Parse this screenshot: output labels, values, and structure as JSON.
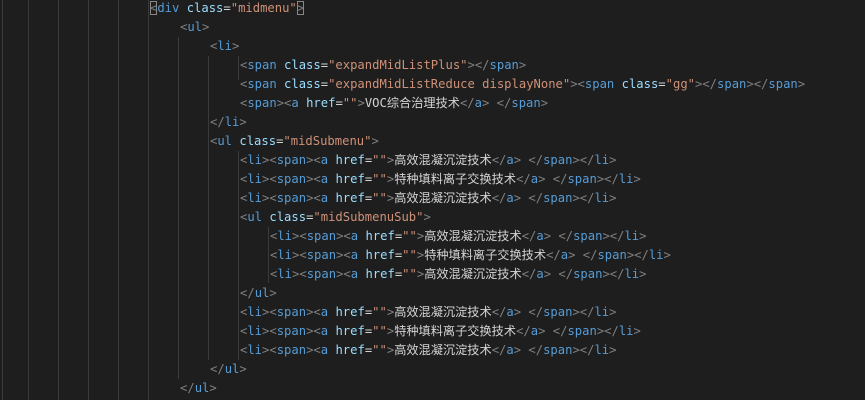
{
  "code_lines": [
    {
      "indent": 0,
      "tokens": [
        {
          "t": "<",
          "c": "ab",
          "m": true
        },
        {
          "t": "div",
          "c": "tg"
        },
        {
          "t": " ",
          "c": "tx"
        },
        {
          "t": "class",
          "c": "at"
        },
        {
          "t": "=",
          "c": "eq"
        },
        {
          "t": "\"midmenu\"",
          "c": "st"
        },
        {
          "t": ">",
          "c": "ab",
          "m": true
        }
      ]
    },
    {
      "indent": 1,
      "tokens": [
        {
          "t": "<",
          "c": "ab"
        },
        {
          "t": "ul",
          "c": "tg"
        },
        {
          "t": ">",
          "c": "ab"
        }
      ]
    },
    {
      "indent": 2,
      "tokens": [
        {
          "t": "<",
          "c": "ab"
        },
        {
          "t": "li",
          "c": "tg"
        },
        {
          "t": ">",
          "c": "ab"
        }
      ]
    },
    {
      "indent": 3,
      "tokens": [
        {
          "t": "<",
          "c": "ab"
        },
        {
          "t": "span",
          "c": "tg"
        },
        {
          "t": " ",
          "c": "tx"
        },
        {
          "t": "class",
          "c": "at"
        },
        {
          "t": "=",
          "c": "eq"
        },
        {
          "t": "\"expandMidListPlus\"",
          "c": "st"
        },
        {
          "t": "></",
          "c": "ab"
        },
        {
          "t": "span",
          "c": "tg"
        },
        {
          "t": ">",
          "c": "ab"
        }
      ]
    },
    {
      "indent": 3,
      "tokens": [
        {
          "t": "<",
          "c": "ab"
        },
        {
          "t": "span",
          "c": "tg"
        },
        {
          "t": " ",
          "c": "tx"
        },
        {
          "t": "class",
          "c": "at"
        },
        {
          "t": "=",
          "c": "eq"
        },
        {
          "t": "\"expandMidListReduce displayNone\"",
          "c": "st"
        },
        {
          "t": "><",
          "c": "ab"
        },
        {
          "t": "span",
          "c": "tg"
        },
        {
          "t": " ",
          "c": "tx"
        },
        {
          "t": "class",
          "c": "at"
        },
        {
          "t": "=",
          "c": "eq"
        },
        {
          "t": "\"gg\"",
          "c": "st"
        },
        {
          "t": "></",
          "c": "ab"
        },
        {
          "t": "span",
          "c": "tg"
        },
        {
          "t": "></",
          "c": "ab"
        },
        {
          "t": "span",
          "c": "tg"
        },
        {
          "t": ">",
          "c": "ab"
        }
      ]
    },
    {
      "indent": 3,
      "tokens": [
        {
          "t": "<",
          "c": "ab"
        },
        {
          "t": "span",
          "c": "tg"
        },
        {
          "t": "><",
          "c": "ab"
        },
        {
          "t": "a",
          "c": "tg"
        },
        {
          "t": " ",
          "c": "tx"
        },
        {
          "t": "href",
          "c": "at"
        },
        {
          "t": "=",
          "c": "eq"
        },
        {
          "t": "\"\"",
          "c": "st"
        },
        {
          "t": ">",
          "c": "ab"
        },
        {
          "t": "VOC综合治理技术",
          "c": "tx"
        },
        {
          "t": "</",
          "c": "ab"
        },
        {
          "t": "a",
          "c": "tg"
        },
        {
          "t": ">",
          "c": "ab"
        },
        {
          "t": " ",
          "c": "tx"
        },
        {
          "t": "</",
          "c": "ab"
        },
        {
          "t": "span",
          "c": "tg"
        },
        {
          "t": ">",
          "c": "ab"
        }
      ]
    },
    {
      "indent": 2,
      "tokens": [
        {
          "t": "</",
          "c": "ab"
        },
        {
          "t": "li",
          "c": "tg"
        },
        {
          "t": ">",
          "c": "ab"
        }
      ]
    },
    {
      "indent": 2,
      "tokens": [
        {
          "t": "<",
          "c": "ab"
        },
        {
          "t": "ul",
          "c": "tg"
        },
        {
          "t": " ",
          "c": "tx"
        },
        {
          "t": "class",
          "c": "at"
        },
        {
          "t": "=",
          "c": "eq"
        },
        {
          "t": "\"midSubmenu\"",
          "c": "st"
        },
        {
          "t": ">",
          "c": "ab"
        }
      ]
    },
    {
      "indent": 3,
      "tokens": [
        {
          "t": "<",
          "c": "ab"
        },
        {
          "t": "li",
          "c": "tg"
        },
        {
          "t": "><",
          "c": "ab"
        },
        {
          "t": "span",
          "c": "tg"
        },
        {
          "t": "><",
          "c": "ab"
        },
        {
          "t": "a",
          "c": "tg"
        },
        {
          "t": " ",
          "c": "tx"
        },
        {
          "t": "href",
          "c": "at"
        },
        {
          "t": "=",
          "c": "eq"
        },
        {
          "t": "\"\"",
          "c": "st"
        },
        {
          "t": ">",
          "c": "ab"
        },
        {
          "t": "高效混凝沉淀技术",
          "c": "tx"
        },
        {
          "t": "</",
          "c": "ab"
        },
        {
          "t": "a",
          "c": "tg"
        },
        {
          "t": ">",
          "c": "ab"
        },
        {
          "t": " ",
          "c": "tx"
        },
        {
          "t": "</",
          "c": "ab"
        },
        {
          "t": "span",
          "c": "tg"
        },
        {
          "t": "></",
          "c": "ab"
        },
        {
          "t": "li",
          "c": "tg"
        },
        {
          "t": ">",
          "c": "ab"
        }
      ]
    },
    {
      "indent": 3,
      "tokens": [
        {
          "t": "<",
          "c": "ab"
        },
        {
          "t": "li",
          "c": "tg"
        },
        {
          "t": "><",
          "c": "ab"
        },
        {
          "t": "span",
          "c": "tg"
        },
        {
          "t": "><",
          "c": "ab"
        },
        {
          "t": "a",
          "c": "tg"
        },
        {
          "t": " ",
          "c": "tx"
        },
        {
          "t": "href",
          "c": "at"
        },
        {
          "t": "=",
          "c": "eq"
        },
        {
          "t": "\"\"",
          "c": "st"
        },
        {
          "t": ">",
          "c": "ab"
        },
        {
          "t": "特种填料离子交换技术",
          "c": "tx"
        },
        {
          "t": "</",
          "c": "ab"
        },
        {
          "t": "a",
          "c": "tg"
        },
        {
          "t": ">",
          "c": "ab"
        },
        {
          "t": " ",
          "c": "tx"
        },
        {
          "t": "</",
          "c": "ab"
        },
        {
          "t": "span",
          "c": "tg"
        },
        {
          "t": "></",
          "c": "ab"
        },
        {
          "t": "li",
          "c": "tg"
        },
        {
          "t": ">",
          "c": "ab"
        }
      ]
    },
    {
      "indent": 3,
      "tokens": [
        {
          "t": "<",
          "c": "ab"
        },
        {
          "t": "li",
          "c": "tg"
        },
        {
          "t": "><",
          "c": "ab"
        },
        {
          "t": "span",
          "c": "tg"
        },
        {
          "t": "><",
          "c": "ab"
        },
        {
          "t": "a",
          "c": "tg"
        },
        {
          "t": " ",
          "c": "tx"
        },
        {
          "t": "href",
          "c": "at"
        },
        {
          "t": "=",
          "c": "eq"
        },
        {
          "t": "\"\"",
          "c": "st"
        },
        {
          "t": ">",
          "c": "ab"
        },
        {
          "t": "高效混凝沉淀技术",
          "c": "tx"
        },
        {
          "t": "</",
          "c": "ab"
        },
        {
          "t": "a",
          "c": "tg"
        },
        {
          "t": ">",
          "c": "ab"
        },
        {
          "t": " ",
          "c": "tx"
        },
        {
          "t": "</",
          "c": "ab"
        },
        {
          "t": "span",
          "c": "tg"
        },
        {
          "t": "></",
          "c": "ab"
        },
        {
          "t": "li",
          "c": "tg"
        },
        {
          "t": ">",
          "c": "ab"
        }
      ]
    },
    {
      "indent": 3,
      "tokens": [
        {
          "t": "<",
          "c": "ab"
        },
        {
          "t": "ul",
          "c": "tg"
        },
        {
          "t": " ",
          "c": "tx"
        },
        {
          "t": "class",
          "c": "at"
        },
        {
          "t": "=",
          "c": "eq"
        },
        {
          "t": "\"midSubmenuSub\"",
          "c": "st"
        },
        {
          "t": ">",
          "c": "ab"
        }
      ]
    },
    {
      "indent": 4,
      "tokens": [
        {
          "t": "<",
          "c": "ab"
        },
        {
          "t": "li",
          "c": "tg"
        },
        {
          "t": "><",
          "c": "ab"
        },
        {
          "t": "span",
          "c": "tg"
        },
        {
          "t": "><",
          "c": "ab"
        },
        {
          "t": "a",
          "c": "tg"
        },
        {
          "t": " ",
          "c": "tx"
        },
        {
          "t": "href",
          "c": "at"
        },
        {
          "t": "=",
          "c": "eq"
        },
        {
          "t": "\"\"",
          "c": "st"
        },
        {
          "t": ">",
          "c": "ab"
        },
        {
          "t": "高效混凝沉淀技术",
          "c": "tx"
        },
        {
          "t": "</",
          "c": "ab"
        },
        {
          "t": "a",
          "c": "tg"
        },
        {
          "t": ">",
          "c": "ab"
        },
        {
          "t": " ",
          "c": "tx"
        },
        {
          "t": "</",
          "c": "ab"
        },
        {
          "t": "span",
          "c": "tg"
        },
        {
          "t": "></",
          "c": "ab"
        },
        {
          "t": "li",
          "c": "tg"
        },
        {
          "t": ">",
          "c": "ab"
        }
      ]
    },
    {
      "indent": 4,
      "tokens": [
        {
          "t": "<",
          "c": "ab"
        },
        {
          "t": "li",
          "c": "tg"
        },
        {
          "t": "><",
          "c": "ab"
        },
        {
          "t": "span",
          "c": "tg"
        },
        {
          "t": "><",
          "c": "ab"
        },
        {
          "t": "a",
          "c": "tg"
        },
        {
          "t": " ",
          "c": "tx"
        },
        {
          "t": "href",
          "c": "at"
        },
        {
          "t": "=",
          "c": "eq"
        },
        {
          "t": "\"\"",
          "c": "st"
        },
        {
          "t": ">",
          "c": "ab"
        },
        {
          "t": "特种填料离子交换技术",
          "c": "tx"
        },
        {
          "t": "</",
          "c": "ab"
        },
        {
          "t": "a",
          "c": "tg"
        },
        {
          "t": ">",
          "c": "ab"
        },
        {
          "t": " ",
          "c": "tx"
        },
        {
          "t": "</",
          "c": "ab"
        },
        {
          "t": "span",
          "c": "tg"
        },
        {
          "t": "></",
          "c": "ab"
        },
        {
          "t": "li",
          "c": "tg"
        },
        {
          "t": ">",
          "c": "ab"
        }
      ]
    },
    {
      "indent": 4,
      "tokens": [
        {
          "t": "<",
          "c": "ab"
        },
        {
          "t": "li",
          "c": "tg"
        },
        {
          "t": "><",
          "c": "ab"
        },
        {
          "t": "span",
          "c": "tg"
        },
        {
          "t": "><",
          "c": "ab"
        },
        {
          "t": "a",
          "c": "tg"
        },
        {
          "t": " ",
          "c": "tx"
        },
        {
          "t": "href",
          "c": "at"
        },
        {
          "t": "=",
          "c": "eq"
        },
        {
          "t": "\"\"",
          "c": "st"
        },
        {
          "t": ">",
          "c": "ab"
        },
        {
          "t": "高效混凝沉淀技术",
          "c": "tx"
        },
        {
          "t": "</",
          "c": "ab"
        },
        {
          "t": "a",
          "c": "tg"
        },
        {
          "t": ">",
          "c": "ab"
        },
        {
          "t": " ",
          "c": "tx"
        },
        {
          "t": "</",
          "c": "ab"
        },
        {
          "t": "span",
          "c": "tg"
        },
        {
          "t": "></",
          "c": "ab"
        },
        {
          "t": "li",
          "c": "tg"
        },
        {
          "t": ">",
          "c": "ab"
        }
      ]
    },
    {
      "indent": 3,
      "tokens": [
        {
          "t": "</",
          "c": "ab"
        },
        {
          "t": "ul",
          "c": "tg"
        },
        {
          "t": ">",
          "c": "ab"
        }
      ]
    },
    {
      "indent": 3,
      "tokens": [
        {
          "t": "<",
          "c": "ab"
        },
        {
          "t": "li",
          "c": "tg"
        },
        {
          "t": "><",
          "c": "ab"
        },
        {
          "t": "span",
          "c": "tg"
        },
        {
          "t": "><",
          "c": "ab"
        },
        {
          "t": "a",
          "c": "tg"
        },
        {
          "t": " ",
          "c": "tx"
        },
        {
          "t": "href",
          "c": "at"
        },
        {
          "t": "=",
          "c": "eq"
        },
        {
          "t": "\"\"",
          "c": "st"
        },
        {
          "t": ">",
          "c": "ab"
        },
        {
          "t": "高效混凝沉淀技术",
          "c": "tx"
        },
        {
          "t": "</",
          "c": "ab"
        },
        {
          "t": "a",
          "c": "tg"
        },
        {
          "t": ">",
          "c": "ab"
        },
        {
          "t": " ",
          "c": "tx"
        },
        {
          "t": "</",
          "c": "ab"
        },
        {
          "t": "span",
          "c": "tg"
        },
        {
          "t": "></",
          "c": "ab"
        },
        {
          "t": "li",
          "c": "tg"
        },
        {
          "t": ">",
          "c": "ab"
        }
      ]
    },
    {
      "indent": 3,
      "tokens": [
        {
          "t": "<",
          "c": "ab"
        },
        {
          "t": "li",
          "c": "tg"
        },
        {
          "t": "><",
          "c": "ab"
        },
        {
          "t": "span",
          "c": "tg"
        },
        {
          "t": "><",
          "c": "ab"
        },
        {
          "t": "a",
          "c": "tg"
        },
        {
          "t": " ",
          "c": "tx"
        },
        {
          "t": "href",
          "c": "at"
        },
        {
          "t": "=",
          "c": "eq"
        },
        {
          "t": "\"\"",
          "c": "st"
        },
        {
          "t": ">",
          "c": "ab"
        },
        {
          "t": "特种填料离子交换技术",
          "c": "tx"
        },
        {
          "t": "</",
          "c": "ab"
        },
        {
          "t": "a",
          "c": "tg"
        },
        {
          "t": ">",
          "c": "ab"
        },
        {
          "t": " ",
          "c": "tx"
        },
        {
          "t": "</",
          "c": "ab"
        },
        {
          "t": "span",
          "c": "tg"
        },
        {
          "t": "></",
          "c": "ab"
        },
        {
          "t": "li",
          "c": "tg"
        },
        {
          "t": ">",
          "c": "ab"
        }
      ]
    },
    {
      "indent": 3,
      "tokens": [
        {
          "t": "<",
          "c": "ab"
        },
        {
          "t": "li",
          "c": "tg"
        },
        {
          "t": "><",
          "c": "ab"
        },
        {
          "t": "span",
          "c": "tg"
        },
        {
          "t": "><",
          "c": "ab"
        },
        {
          "t": "a",
          "c": "tg"
        },
        {
          "t": " ",
          "c": "tx"
        },
        {
          "t": "href",
          "c": "at"
        },
        {
          "t": "=",
          "c": "eq"
        },
        {
          "t": "\"\"",
          "c": "st"
        },
        {
          "t": ">",
          "c": "ab"
        },
        {
          "t": "高效混凝沉淀技术",
          "c": "tx"
        },
        {
          "t": "</",
          "c": "ab"
        },
        {
          "t": "a",
          "c": "tg"
        },
        {
          "t": ">",
          "c": "ab"
        },
        {
          "t": " ",
          "c": "tx"
        },
        {
          "t": "</",
          "c": "ab"
        },
        {
          "t": "span",
          "c": "tg"
        },
        {
          "t": "></",
          "c": "ab"
        },
        {
          "t": "li",
          "c": "tg"
        },
        {
          "t": ">",
          "c": "ab"
        }
      ]
    },
    {
      "indent": 2,
      "tokens": [
        {
          "t": "</",
          "c": "ab"
        },
        {
          "t": "ul",
          "c": "tg"
        },
        {
          "t": ">",
          "c": "ab"
        }
      ]
    },
    {
      "indent": 1,
      "tokens": [
        {
          "t": "</",
          "c": "ab"
        },
        {
          "t": "ul",
          "c": "tg"
        },
        {
          "t": ">",
          "c": "ab"
        }
      ]
    }
  ]
}
